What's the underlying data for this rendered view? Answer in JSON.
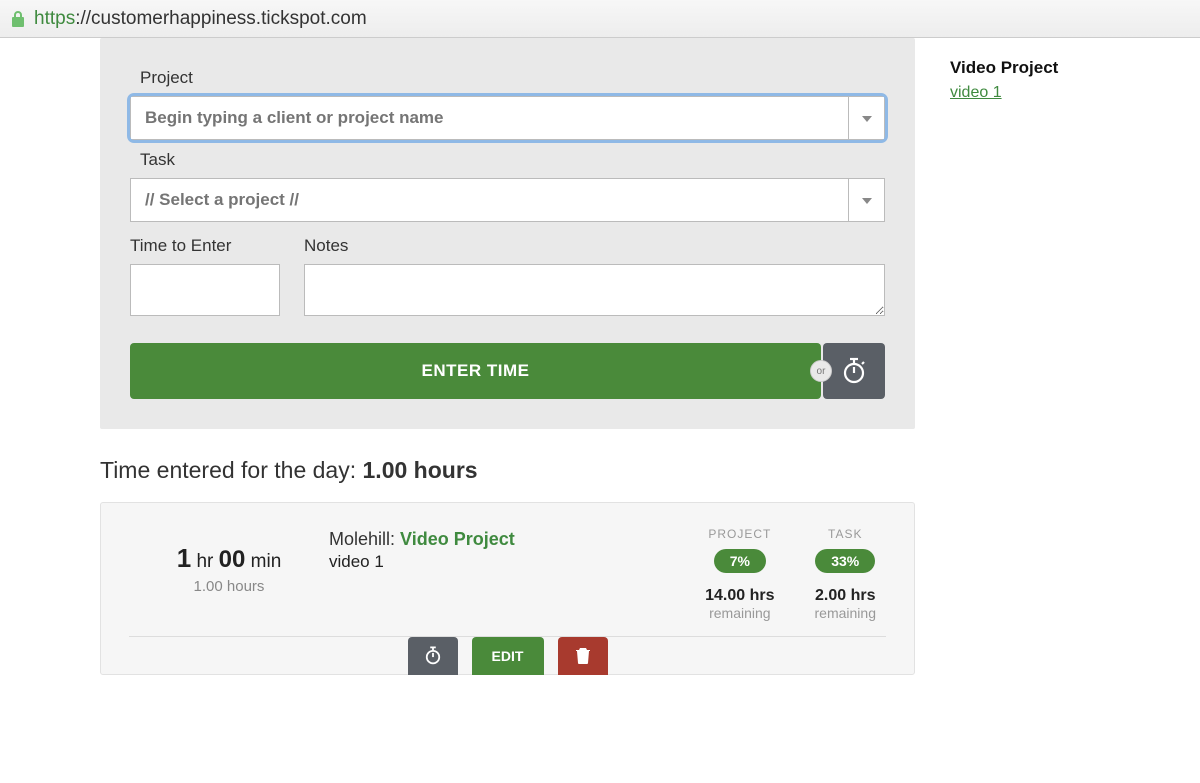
{
  "url": {
    "secure_part": "https",
    "rest": "://customerhappiness.tickspot.com"
  },
  "form": {
    "project_label": "Project",
    "project_placeholder": "Begin typing a client or project name",
    "task_label": "Task",
    "task_placeholder": "// Select a project //",
    "time_label": "Time to Enter",
    "notes_label": "Notes",
    "enter_button": "ENTER TIME",
    "or_text": "or"
  },
  "sidebar": {
    "title": "Video Project",
    "link": "video 1"
  },
  "summary": {
    "prefix": "Time entered for the day: ",
    "value": "1.00 hours"
  },
  "entry": {
    "hr_num": "1",
    "hr_unit": "hr",
    "min_num": "00",
    "min_unit": "min",
    "hours_text": "1.00 hours",
    "client": "Molehill:",
    "project": "Video Project",
    "task": "video 1",
    "stats": {
      "project_label": "PROJECT",
      "project_pct": "7%",
      "project_hrs": "14.00 hrs",
      "project_rem": "remaining",
      "task_label": "TASK",
      "task_pct": "33%",
      "task_hrs": "2.00 hrs",
      "task_rem": "remaining"
    },
    "actions": {
      "edit": "EDIT"
    }
  }
}
